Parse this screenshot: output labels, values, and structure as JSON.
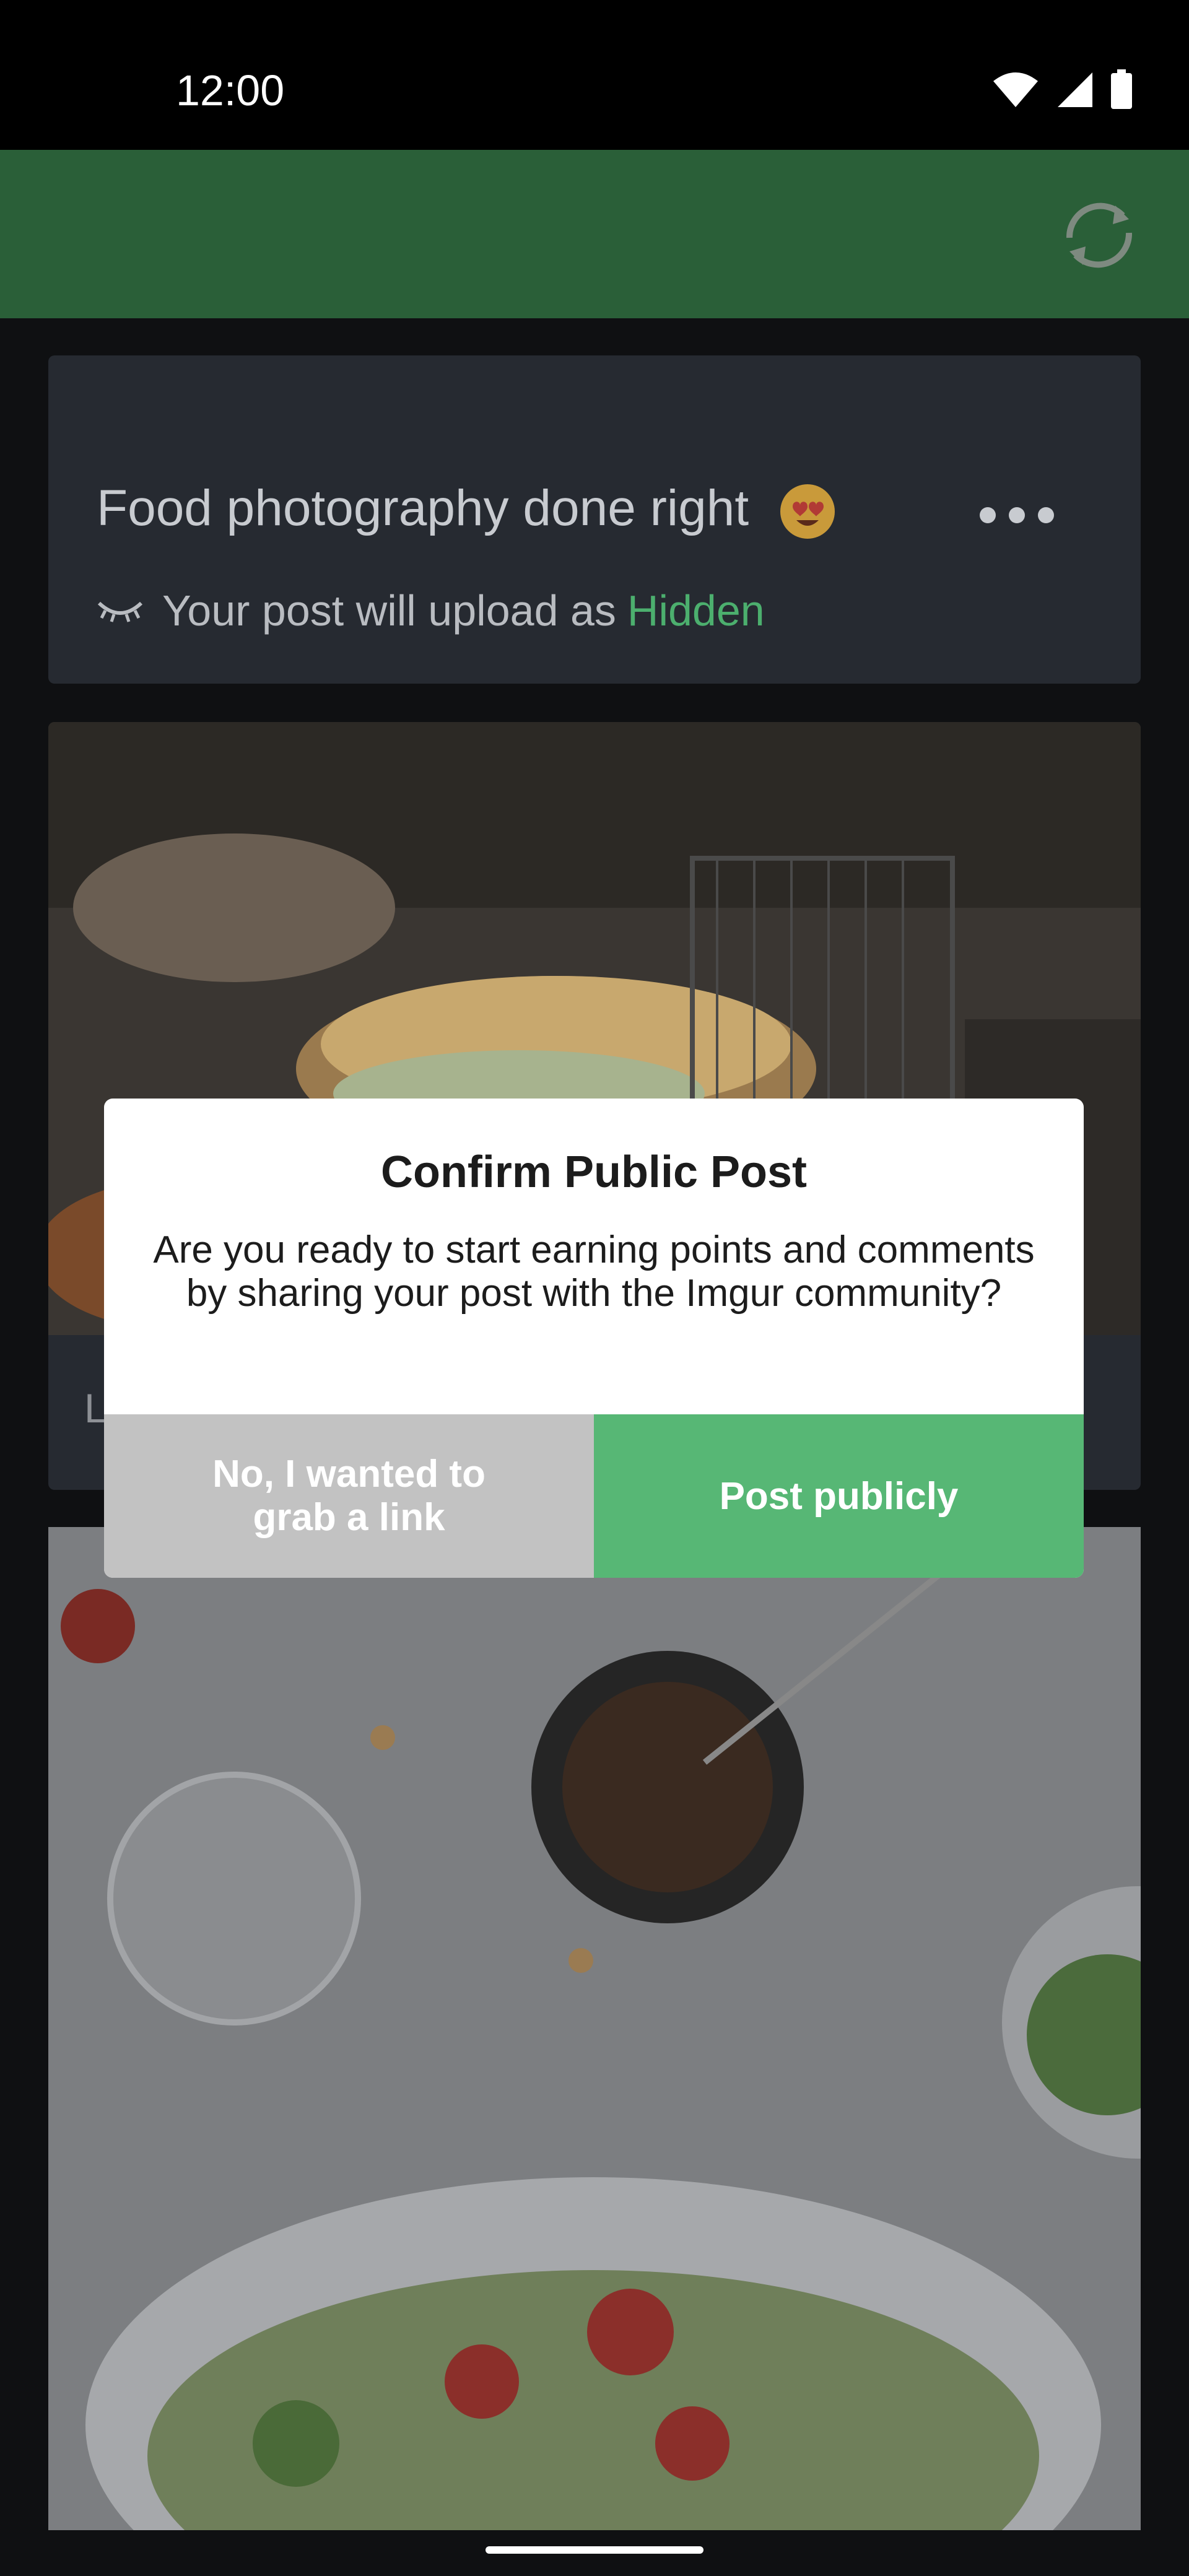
{
  "status_bar": {
    "time": "12:00",
    "icons": [
      "wifi-icon",
      "signal-icon",
      "battery-icon"
    ]
  },
  "app_bar": {
    "background_color": "#2a5f38",
    "refresh_icon": "refresh-icon"
  },
  "post": {
    "title": "Food photography done right",
    "title_emoji": "heart-eyes-emoji",
    "upload_prefix": "Your post will upload as",
    "visibility": "Hidden",
    "visibility_color": "#4caf6e"
  },
  "image_card_1": {
    "caption_placeholder": "L"
  },
  "dialog": {
    "title": "Confirm Public Post",
    "message": "Are you ready to start earning points and comments by sharing your post with the Imgur community?",
    "secondary_label": "No, I wanted to grab a link",
    "primary_label": "Post publicly",
    "primary_color": "#57b775",
    "secondary_color": "#c2c2c2"
  }
}
